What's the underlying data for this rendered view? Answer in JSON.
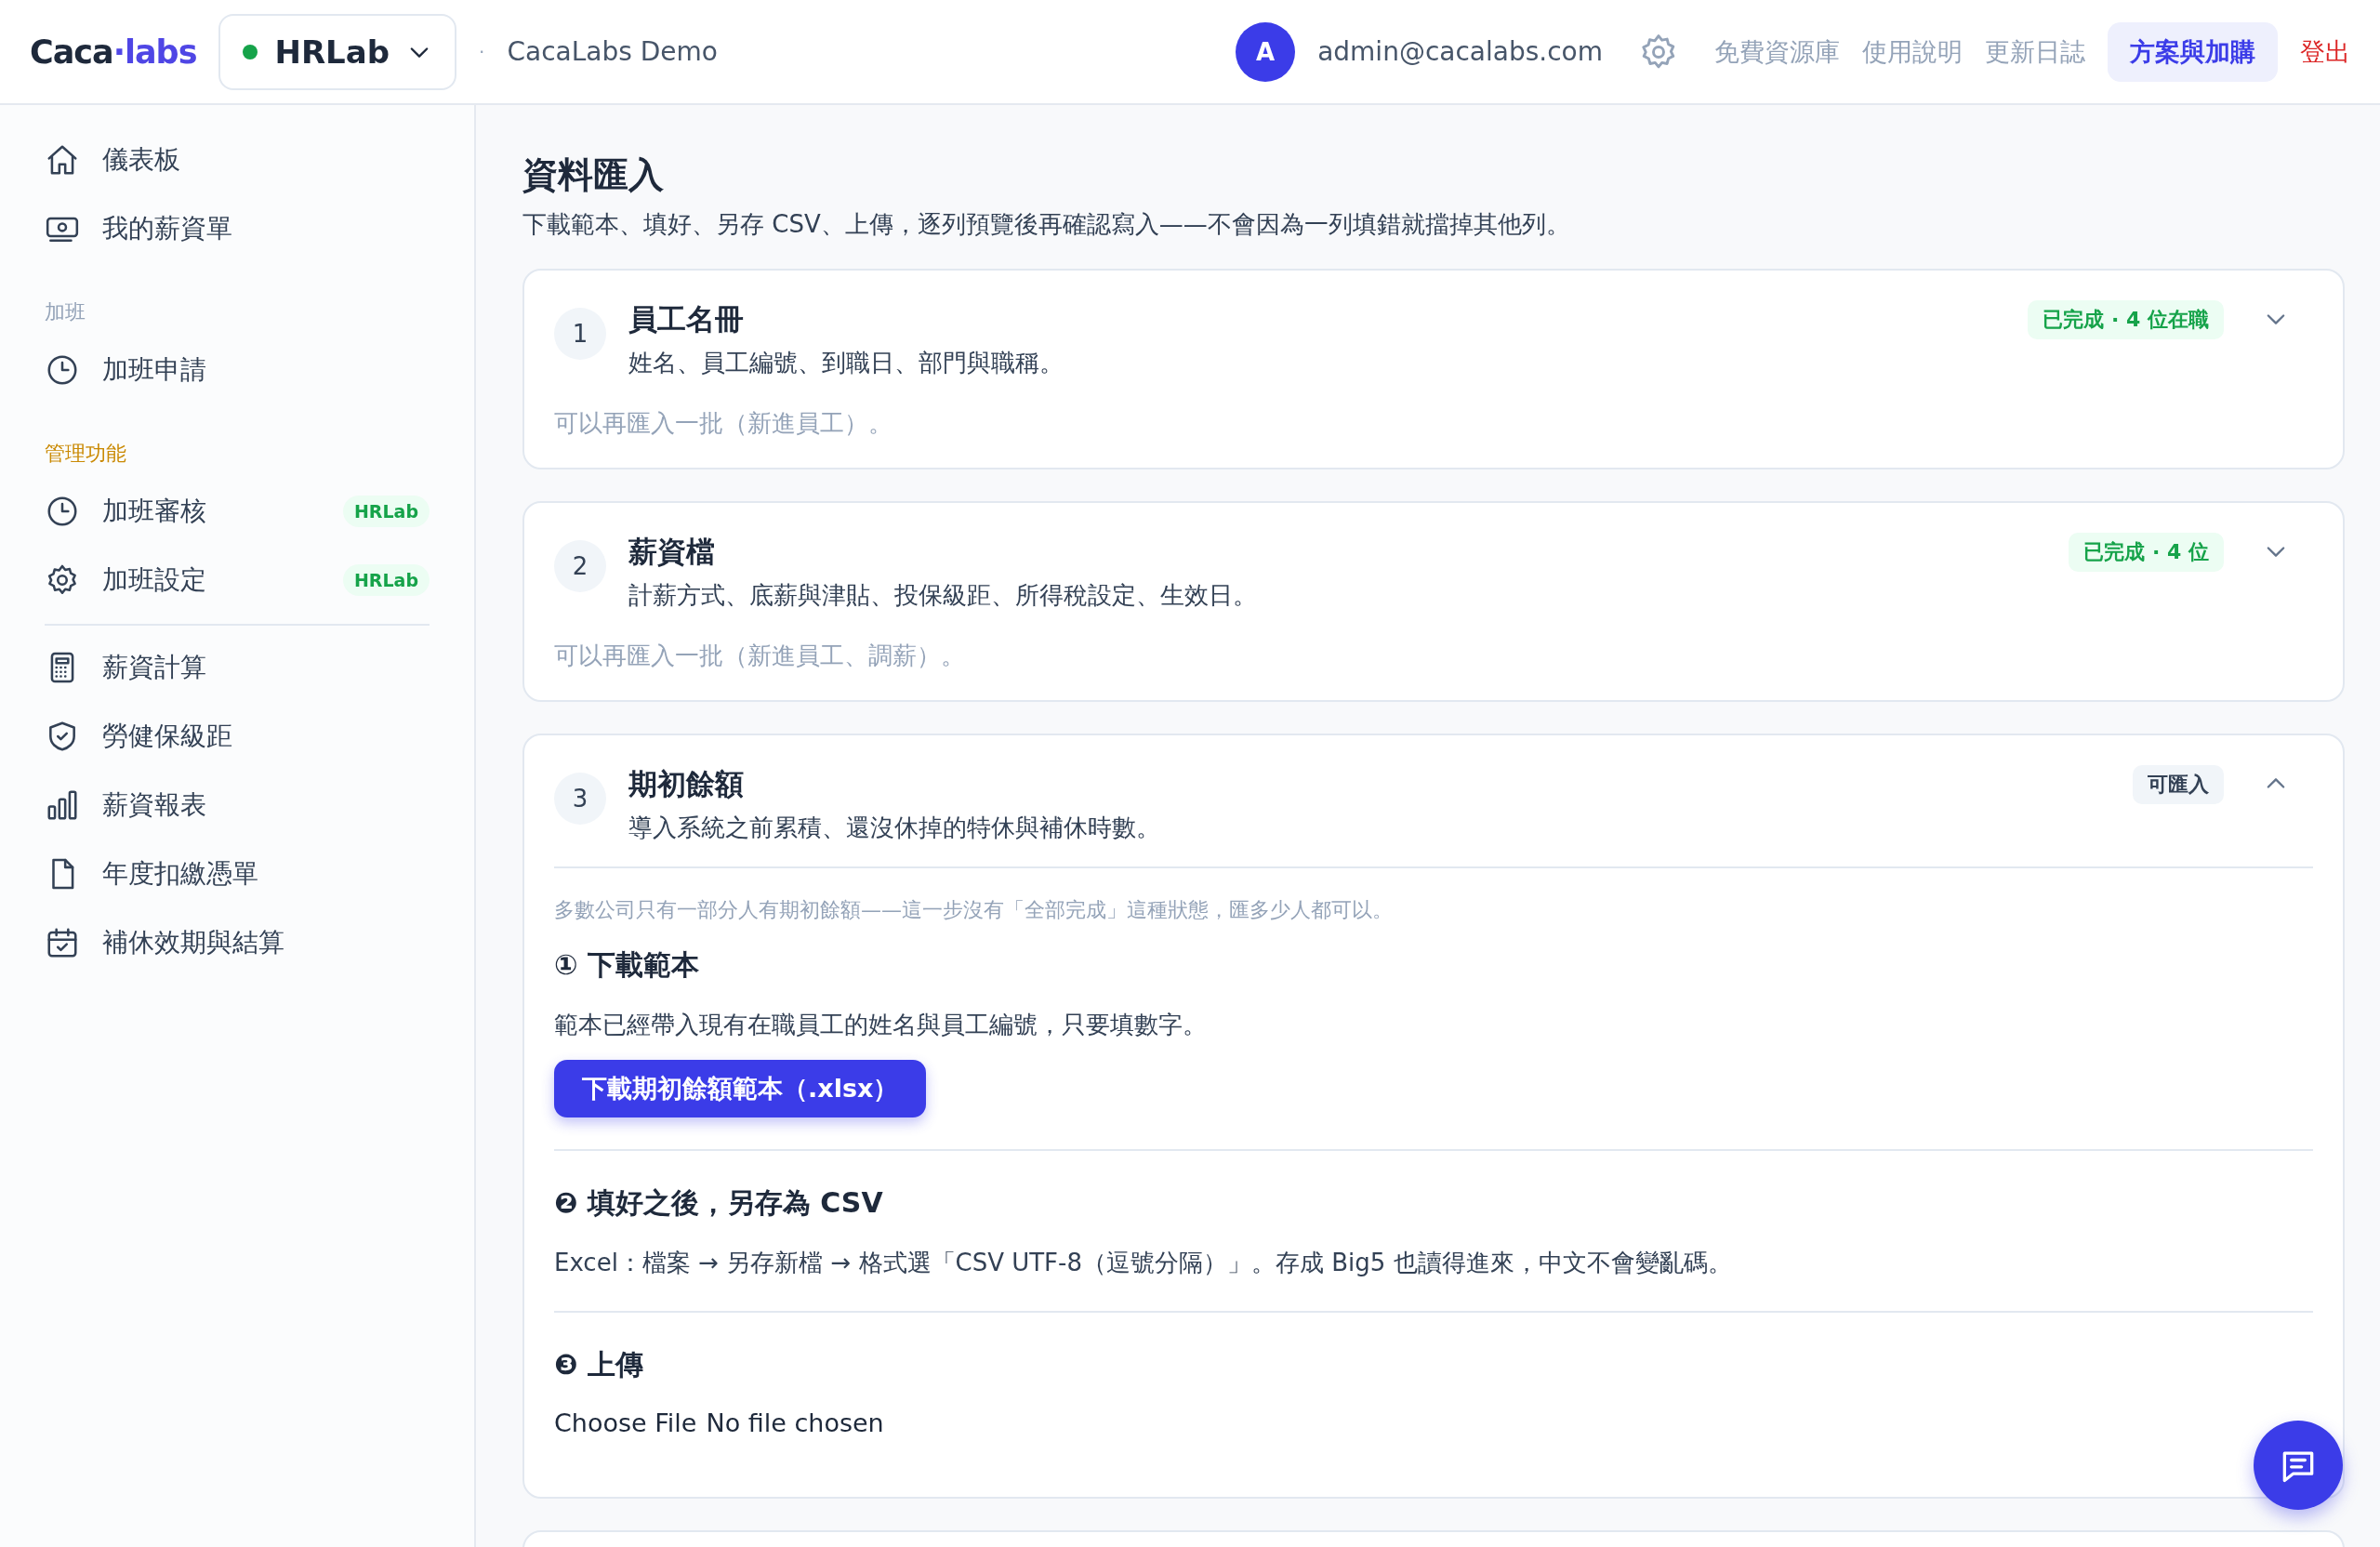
{
  "header": {
    "logo": {
      "primary": "Caca",
      "accent": "·labs"
    },
    "workspace": {
      "name": "HRLab",
      "online": true
    },
    "separator": "·",
    "org": "CacaLabs Demo",
    "user": {
      "avatar": "A",
      "email": "admin@cacalabs.com"
    },
    "links": [
      "免費資源庫",
      "使用說明",
      "更新日誌"
    ],
    "plan_button": "方案與加購",
    "logout": "登出"
  },
  "sidebar": {
    "sections": [
      {
        "items": [
          {
            "label": "儀表板"
          },
          {
            "label": "我的薪資單"
          }
        ]
      },
      {
        "title": "加班",
        "highlight": false,
        "items": [
          {
            "label": "加班申請"
          }
        ]
      },
      {
        "title": "管理功能",
        "highlight": true,
        "items": [
          {
            "label": "加班審核",
            "badge": "HRLab"
          },
          {
            "label": "加班設定",
            "badge": "HRLab"
          }
        ]
      },
      {
        "divider": true,
        "items": [
          {
            "label": "薪資計算"
          },
          {
            "label": "勞健保級距"
          },
          {
            "label": "薪資報表"
          },
          {
            "label": "年度扣繳憑單"
          },
          {
            "label": "補休效期與結算"
          }
        ]
      }
    ]
  },
  "main": {
    "title": "資料匯入",
    "description": "下載範本、填好、另存 CSV、上傳，逐列預覽後再確認寫入——不會因為一列填錯就擋掉其他列。",
    "steps": [
      {
        "number": "1",
        "title": "員工名冊",
        "subtitle": "姓名、員工編號、到職日、部門與職稱。",
        "status": {
          "label": "已完成 · 4 位在職",
          "complete": true
        },
        "expanded": false,
        "note": "可以再匯入一批（新進員工）。"
      },
      {
        "number": "2",
        "title": "薪資檔",
        "subtitle": "計薪方式、底薪與津貼、投保級距、所得稅設定、生效日。",
        "status": {
          "label": "已完成 · 4 位",
          "complete": true
        },
        "expanded": false,
        "note": "可以再匯入一批（新進員工、調薪）。"
      },
      {
        "number": "3",
        "title": "期初餘額",
        "subtitle": "導入系統之前累積、還沒休掉的特休與補休時數。",
        "status": {
          "label": "可匯入",
          "complete": false
        },
        "expanded": true,
        "note": "多數公司只有一部分人有期初餘額——這一步沒有「全部完成」這種狀態，匯多少人都可以。",
        "parts": [
          {
            "kind": "download",
            "heading": "① 下載範本",
            "text": "範本已經帶入現有在職員工的姓名與員工編號，只要填數字。",
            "button": "下載期初餘額範本（.xlsx）"
          },
          {
            "kind": "info",
            "heading": "❷ 填好之後，另存為 CSV",
            "text": "Excel：檔案 → 另存新檔 → 格式選「CSV UTF-8（逗號分隔）」。存成 Big5 也讀得進來，中文不會變亂碼。"
          },
          {
            "kind": "upload",
            "heading": "❸ 上傳",
            "file_button": "Choose File",
            "file_status": "No file chosen"
          }
        ]
      }
    ],
    "more_below": true
  }
}
